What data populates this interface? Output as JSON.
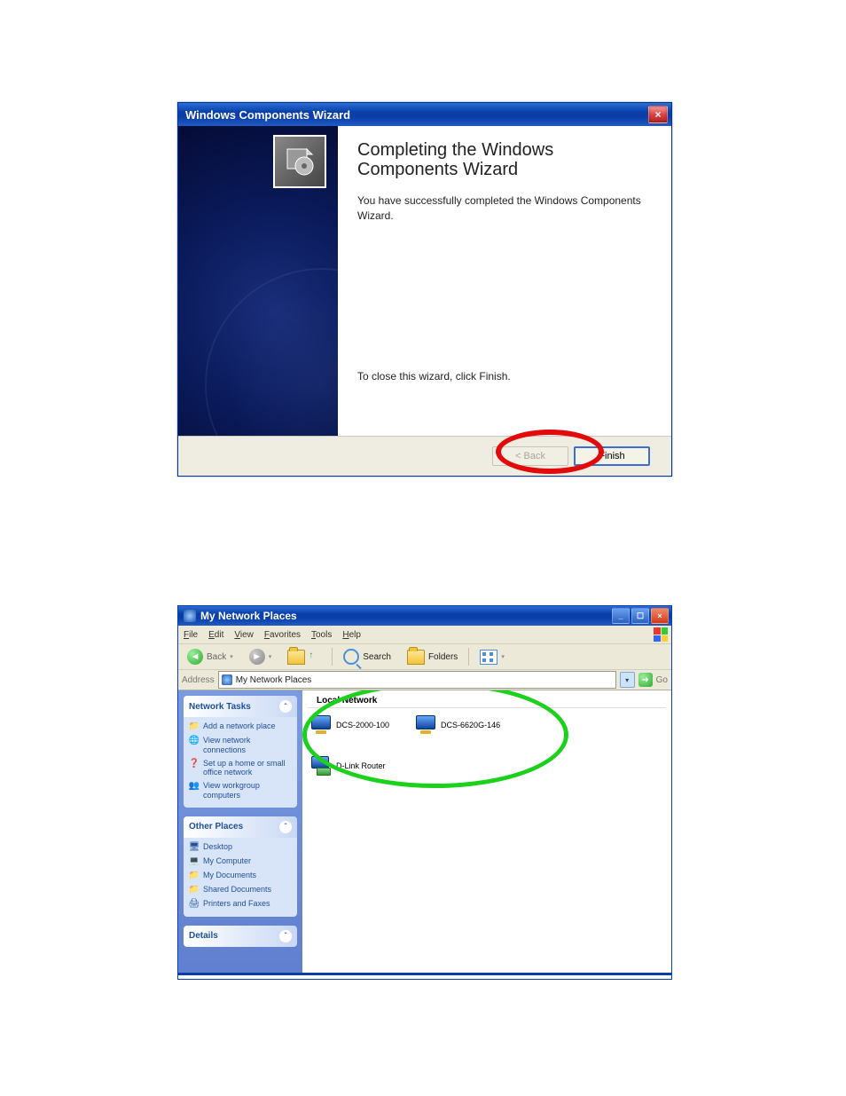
{
  "wizard": {
    "title": "Windows Components Wizard",
    "heading": "Completing the Windows Components Wizard",
    "message": "You have successfully completed the Windows Components Wizard.",
    "closeHint": "To close this wizard, click Finish.",
    "buttons": {
      "back": "< Back",
      "finish": "Finish"
    }
  },
  "explorer": {
    "title": "My Network Places",
    "menu": [
      "File",
      "Edit",
      "View",
      "Favorites",
      "Tools",
      "Help"
    ],
    "toolbar": {
      "back": "Back",
      "search": "Search",
      "folders": "Folders"
    },
    "address": {
      "label": "Address",
      "value": "My Network Places",
      "go": "Go"
    },
    "sidebar": {
      "tasks": {
        "title": "Network Tasks",
        "items": [
          "Add a network place",
          "View network connections",
          "Set up a home or small office network",
          "View workgroup computers"
        ]
      },
      "other": {
        "title": "Other Places",
        "items": [
          "Desktop",
          "My Computer",
          "My Documents",
          "Shared Documents",
          "Printers and Faxes"
        ]
      },
      "details": {
        "title": "Details"
      }
    },
    "contentTitle": "Local Network",
    "items": [
      {
        "name": "DCS-2000-100",
        "type": "device"
      },
      {
        "name": "DCS-6620G-146",
        "type": "device"
      },
      {
        "name": "D-Link Router",
        "type": "router"
      }
    ]
  }
}
